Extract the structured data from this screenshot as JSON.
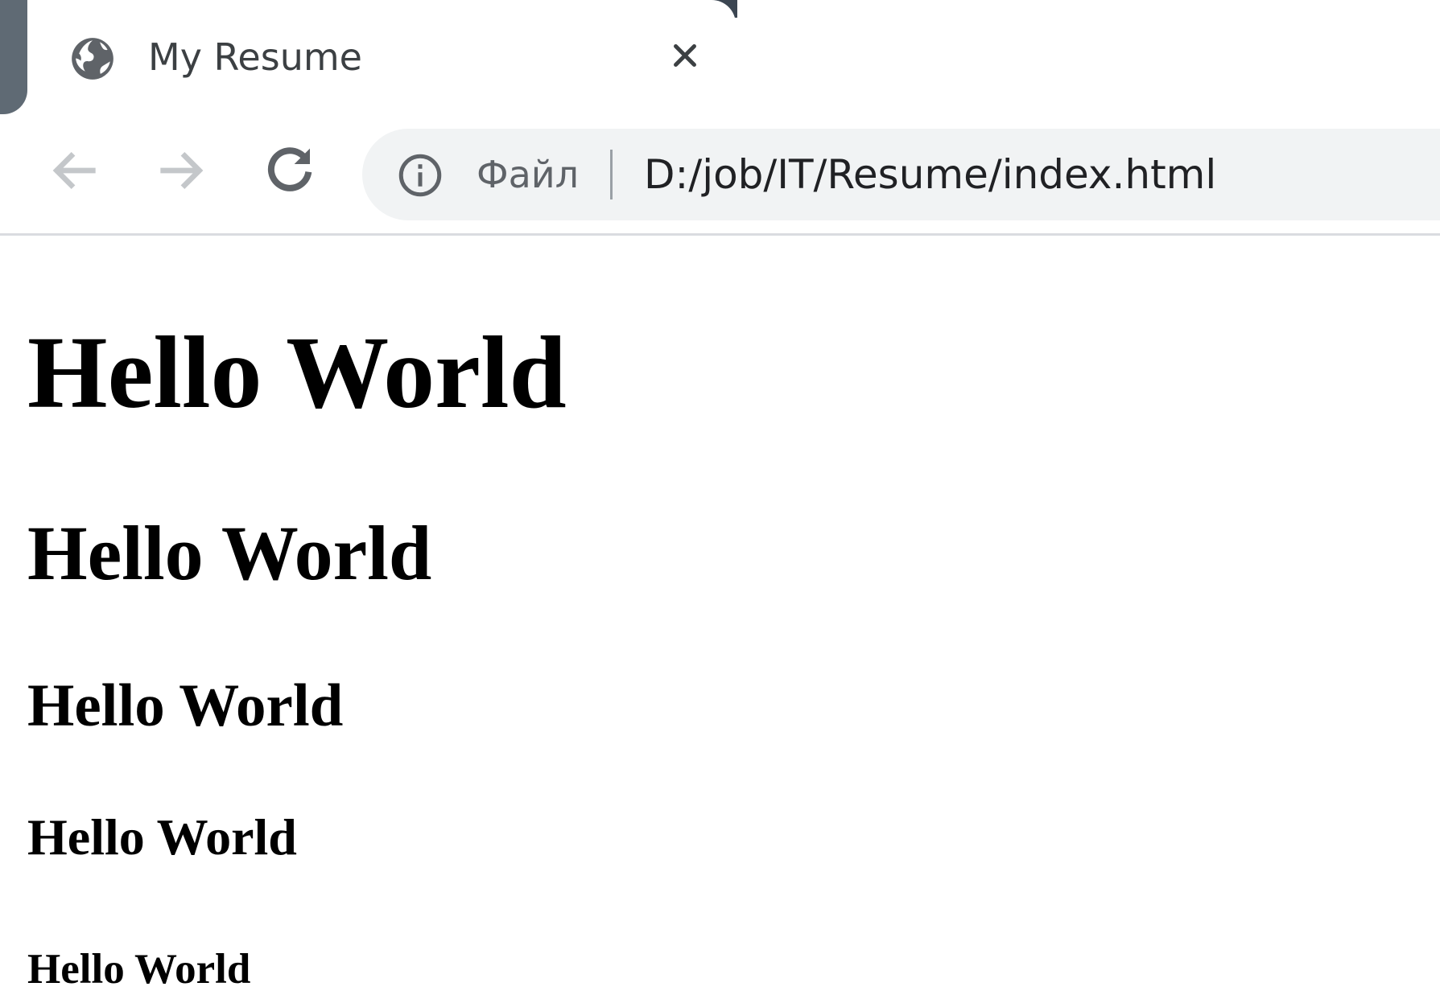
{
  "tab": {
    "title": "My Resume",
    "icon": "globe-icon",
    "close_icon": "close-icon"
  },
  "toolbar": {
    "back_icon": "back-arrow-icon",
    "forward_icon": "forward-arrow-icon",
    "reload_icon": "reload-icon",
    "info_icon": "info-icon",
    "scheme_label": "Файл",
    "url": "D:/job/IT/Resume/index.html"
  },
  "page": {
    "h1": "Hello World",
    "h2": "Hello World",
    "h3": "Hello World",
    "h4": "Hello World",
    "h5": "Hello World"
  },
  "colors": {
    "tab_text": "#3c4043",
    "omnibox_bg": "#f1f3f4",
    "frame": "#5f6a74"
  }
}
